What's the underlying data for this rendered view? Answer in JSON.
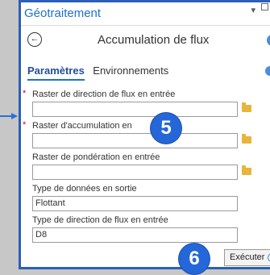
{
  "window": {
    "title": "Géotraitement",
    "dropdown_glyph": "▾"
  },
  "tool": {
    "back_glyph": "←",
    "title": "Accumulation de flux"
  },
  "tabs": [
    {
      "label": "Paramètres",
      "active": true
    },
    {
      "label": "Environnements",
      "active": false
    }
  ],
  "params": [
    {
      "label": "Raster de direction de flux en entrée",
      "required": true,
      "value": "",
      "browse": true
    },
    {
      "label": "Raster d'accumulation en",
      "required": true,
      "value": "",
      "browse": true
    },
    {
      "label": "Raster de pondération en entrée",
      "required": false,
      "value": "",
      "browse": true
    },
    {
      "label": "Type de données en sortie",
      "required": false,
      "value": "Flottant",
      "browse": false
    },
    {
      "label": "Type de direction de flux en entrée",
      "required": false,
      "value": "D8",
      "browse": false
    }
  ],
  "required_marker": "*",
  "badges": {
    "step5": "5",
    "step6": "6"
  },
  "run_button": {
    "label": "Exécuter"
  },
  "colors": {
    "accent": "#2b5fb8",
    "badge": "#2567d8",
    "required": "#d0021b",
    "folder": "#e6b53a"
  }
}
